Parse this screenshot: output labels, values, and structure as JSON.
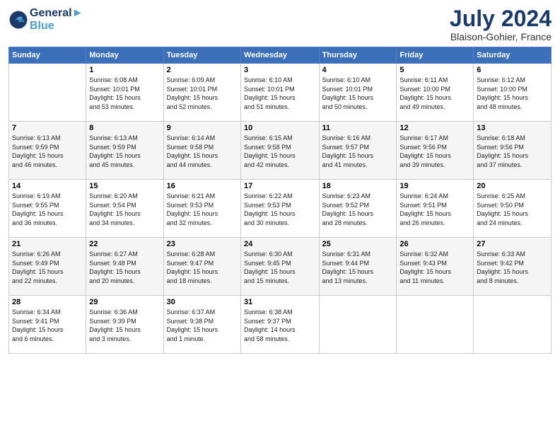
{
  "header": {
    "logo_line1": "General",
    "logo_line2": "Blue",
    "month": "July 2024",
    "location": "Blaison-Gohier, France"
  },
  "weekdays": [
    "Sunday",
    "Monday",
    "Tuesday",
    "Wednesday",
    "Thursday",
    "Friday",
    "Saturday"
  ],
  "weeks": [
    [
      {
        "day": "",
        "info": ""
      },
      {
        "day": "1",
        "info": "Sunrise: 6:08 AM\nSunset: 10:01 PM\nDaylight: 15 hours\nand 53 minutes."
      },
      {
        "day": "2",
        "info": "Sunrise: 6:09 AM\nSunset: 10:01 PM\nDaylight: 15 hours\nand 52 minutes."
      },
      {
        "day": "3",
        "info": "Sunrise: 6:10 AM\nSunset: 10:01 PM\nDaylight: 15 hours\nand 51 minutes."
      },
      {
        "day": "4",
        "info": "Sunrise: 6:10 AM\nSunset: 10:01 PM\nDaylight: 15 hours\nand 50 minutes."
      },
      {
        "day": "5",
        "info": "Sunrise: 6:11 AM\nSunset: 10:00 PM\nDaylight: 15 hours\nand 49 minutes."
      },
      {
        "day": "6",
        "info": "Sunrise: 6:12 AM\nSunset: 10:00 PM\nDaylight: 15 hours\nand 48 minutes."
      }
    ],
    [
      {
        "day": "7",
        "info": "Sunrise: 6:13 AM\nSunset: 9:59 PM\nDaylight: 15 hours\nand 46 minutes."
      },
      {
        "day": "8",
        "info": "Sunrise: 6:13 AM\nSunset: 9:59 PM\nDaylight: 15 hours\nand 45 minutes."
      },
      {
        "day": "9",
        "info": "Sunrise: 6:14 AM\nSunset: 9:58 PM\nDaylight: 15 hours\nand 44 minutes."
      },
      {
        "day": "10",
        "info": "Sunrise: 6:15 AM\nSunset: 9:58 PM\nDaylight: 15 hours\nand 42 minutes."
      },
      {
        "day": "11",
        "info": "Sunrise: 6:16 AM\nSunset: 9:57 PM\nDaylight: 15 hours\nand 41 minutes."
      },
      {
        "day": "12",
        "info": "Sunrise: 6:17 AM\nSunset: 9:56 PM\nDaylight: 15 hours\nand 39 minutes."
      },
      {
        "day": "13",
        "info": "Sunrise: 6:18 AM\nSunset: 9:56 PM\nDaylight: 15 hours\nand 37 minutes."
      }
    ],
    [
      {
        "day": "14",
        "info": "Sunrise: 6:19 AM\nSunset: 9:55 PM\nDaylight: 15 hours\nand 36 minutes."
      },
      {
        "day": "15",
        "info": "Sunrise: 6:20 AM\nSunset: 9:54 PM\nDaylight: 15 hours\nand 34 minutes."
      },
      {
        "day": "16",
        "info": "Sunrise: 6:21 AM\nSunset: 9:53 PM\nDaylight: 15 hours\nand 32 minutes."
      },
      {
        "day": "17",
        "info": "Sunrise: 6:22 AM\nSunset: 9:53 PM\nDaylight: 15 hours\nand 30 minutes."
      },
      {
        "day": "18",
        "info": "Sunrise: 6:23 AM\nSunset: 9:52 PM\nDaylight: 15 hours\nand 28 minutes."
      },
      {
        "day": "19",
        "info": "Sunrise: 6:24 AM\nSunset: 9:51 PM\nDaylight: 15 hours\nand 26 minutes."
      },
      {
        "day": "20",
        "info": "Sunrise: 6:25 AM\nSunset: 9:50 PM\nDaylight: 15 hours\nand 24 minutes."
      }
    ],
    [
      {
        "day": "21",
        "info": "Sunrise: 6:26 AM\nSunset: 9:49 PM\nDaylight: 15 hours\nand 22 minutes."
      },
      {
        "day": "22",
        "info": "Sunrise: 6:27 AM\nSunset: 9:48 PM\nDaylight: 15 hours\nand 20 minutes."
      },
      {
        "day": "23",
        "info": "Sunrise: 6:28 AM\nSunset: 9:47 PM\nDaylight: 15 hours\nand 18 minutes."
      },
      {
        "day": "24",
        "info": "Sunrise: 6:30 AM\nSunset: 9:45 PM\nDaylight: 15 hours\nand 15 minutes."
      },
      {
        "day": "25",
        "info": "Sunrise: 6:31 AM\nSunset: 9:44 PM\nDaylight: 15 hours\nand 13 minutes."
      },
      {
        "day": "26",
        "info": "Sunrise: 6:32 AM\nSunset: 9:43 PM\nDaylight: 15 hours\nand 11 minutes."
      },
      {
        "day": "27",
        "info": "Sunrise: 6:33 AM\nSunset: 9:42 PM\nDaylight: 15 hours\nand 8 minutes."
      }
    ],
    [
      {
        "day": "28",
        "info": "Sunrise: 6:34 AM\nSunset: 9:41 PM\nDaylight: 15 hours\nand 6 minutes."
      },
      {
        "day": "29",
        "info": "Sunrise: 6:36 AM\nSunset: 9:39 PM\nDaylight: 15 hours\nand 3 minutes."
      },
      {
        "day": "30",
        "info": "Sunrise: 6:37 AM\nSunset: 9:38 PM\nDaylight: 15 hours\nand 1 minute."
      },
      {
        "day": "31",
        "info": "Sunrise: 6:38 AM\nSunset: 9:37 PM\nDaylight: 14 hours\nand 58 minutes."
      },
      {
        "day": "",
        "info": ""
      },
      {
        "day": "",
        "info": ""
      },
      {
        "day": "",
        "info": ""
      }
    ]
  ]
}
